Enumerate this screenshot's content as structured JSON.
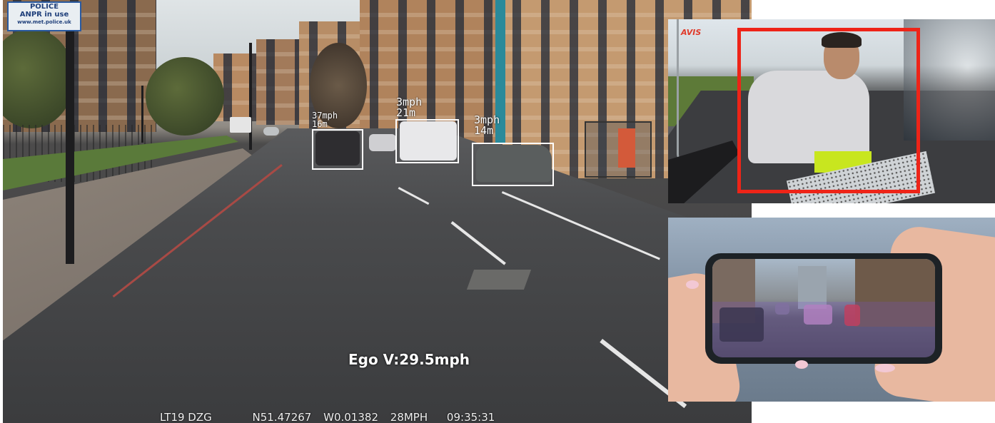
{
  "main": {
    "sign_text": [
      "POLICE",
      "ANPR in use",
      "www.met.police.uk"
    ],
    "detections": [
      {
        "speed": "37mph",
        "distance": "16m"
      },
      {
        "speed": "3mph",
        "distance": "21m"
      },
      {
        "speed": "3mph",
        "distance": "14m"
      }
    ],
    "ego_speed": "Ego V:29.5mph",
    "overlay": {
      "plate": "LT19 DZG",
      "lat": "N51.47267",
      "lon": "W0.01382",
      "speed": "28MPH",
      "time": "09:35:31"
    },
    "box_color": "#ffffff"
  },
  "top_right": {
    "logo": "AVIS",
    "highlight_color": "#ee2418",
    "accent_shorts": "#c8e61f"
  },
  "bottom_right": {
    "overlay_tint": "#7850c8"
  }
}
